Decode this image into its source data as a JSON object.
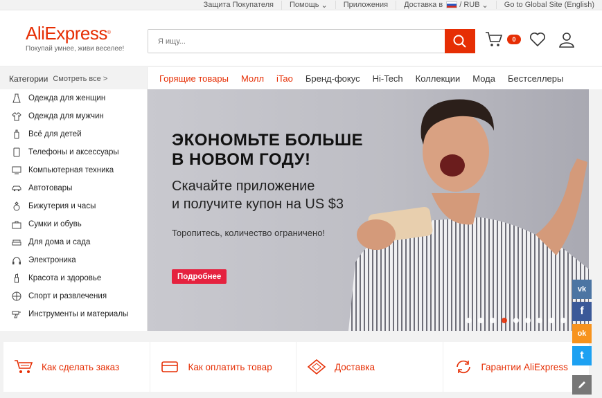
{
  "topbar": {
    "buyer_protection": "Защита Покупателя",
    "help": "Помощь",
    "apps": "Приложения",
    "delivery": "Доставка в",
    "currency": "/ RUB",
    "global_site": "Go to Global Site (English)"
  },
  "header": {
    "logo": "AliExpress",
    "tagline": "Покупай умнее, живи веселее!",
    "search_placeholder": "Я ищу...",
    "cart_count": "0"
  },
  "nav": {
    "categories": "Категории",
    "see_all": "Смотреть все >",
    "links": [
      "Горящие товары",
      "Молл",
      "iTao",
      "Бренд-фокус",
      "Hi-Tech",
      "Коллекции",
      "Мода",
      "Бестселлеры"
    ]
  },
  "sidebar": {
    "items": [
      {
        "label": "Одежда для женщин",
        "icon": "dress-icon"
      },
      {
        "label": "Одежда для мужчин",
        "icon": "shirt-icon"
      },
      {
        "label": "Всё для детей",
        "icon": "baby-bottle-icon"
      },
      {
        "label": "Телефоны и аксессуары",
        "icon": "phone-icon"
      },
      {
        "label": "Компьютерная техника",
        "icon": "monitor-icon"
      },
      {
        "label": "Автотовары",
        "icon": "car-icon"
      },
      {
        "label": "Бижутерия и часы",
        "icon": "ring-icon"
      },
      {
        "label": "Сумки и обувь",
        "icon": "bag-icon"
      },
      {
        "label": "Для дома и сада",
        "icon": "sofa-icon"
      },
      {
        "label": "Электроника",
        "icon": "headphones-icon"
      },
      {
        "label": "Красота и здоровье",
        "icon": "lipstick-icon"
      },
      {
        "label": "Спорт и развлечения",
        "icon": "ball-icon"
      },
      {
        "label": "Инструменты и материалы",
        "icon": "drill-icon"
      }
    ]
  },
  "banner": {
    "headline_1": "ЭКОНОМЬТЕ БОЛЬШЕ",
    "headline_2": "В НОВОМ ГОДУ!",
    "sub_1": "Скачайте приложение",
    "sub_2": "и получите купон на US $3",
    "note": "Торопитесь, количество ограничено!",
    "button": "Подробнее",
    "slides": 9,
    "active_slide": 3
  },
  "features": [
    {
      "label": "Как сделать заказ",
      "icon": "cart-icon"
    },
    {
      "label": "Как оплатить товар",
      "icon": "card-icon"
    },
    {
      "label": "Доставка",
      "icon": "box-icon"
    },
    {
      "label": "Гарантии AliExpress",
      "icon": "refresh-icon"
    }
  ],
  "social": {
    "vk": "vk",
    "fb": "f",
    "ok": "ok",
    "tw": "t"
  },
  "colors": {
    "accent": "#e62e04",
    "button": "#e5223f"
  }
}
